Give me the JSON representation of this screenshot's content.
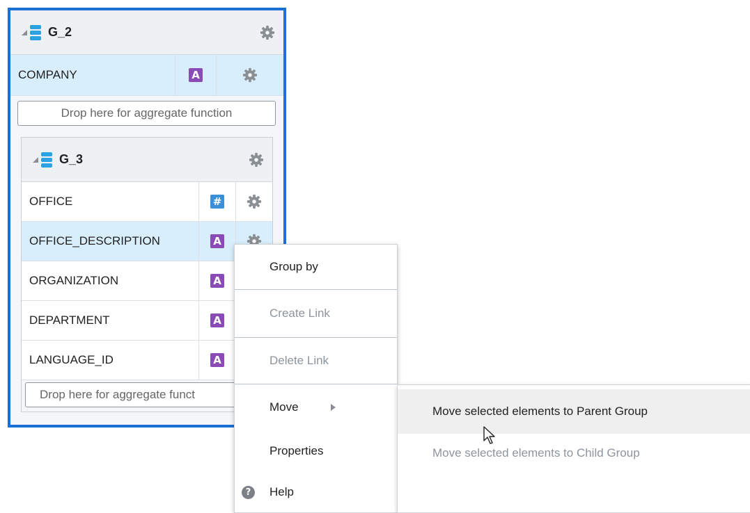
{
  "group_outer": {
    "name": "G_2",
    "fields": [
      {
        "name": "COMPANY",
        "type": "A",
        "selected": true
      }
    ],
    "drop_text": "Drop here for aggregate function"
  },
  "group_inner": {
    "name": "G_3",
    "fields": [
      {
        "name": "OFFICE",
        "type": "#",
        "selected": false
      },
      {
        "name": "OFFICE_DESCRIPTION",
        "type": "A",
        "selected": true
      },
      {
        "name": "ORGANIZATION",
        "type": "A",
        "selected": false
      },
      {
        "name": "DEPARTMENT",
        "type": "A",
        "selected": false
      },
      {
        "name": "LANGUAGE_ID",
        "type": "A",
        "selected": false
      }
    ],
    "drop_text": "Drop here for aggregate funct"
  },
  "context_menu": {
    "group_by": "Group by",
    "create_link": "Create Link",
    "delete_link": "Delete Link",
    "move": "Move",
    "properties": "Properties",
    "help": "Help"
  },
  "submenu": {
    "to_parent": "Move selected elements to Parent Group",
    "to_child": "Move selected elements to Child Group"
  },
  "colors": {
    "accent_border": "#1c6fd4",
    "selected_row": "#d9eefc",
    "alpha_badge": "#8a4bb6",
    "numeric_badge": "#3b8fd8",
    "disabled_text": "#8d959c"
  }
}
